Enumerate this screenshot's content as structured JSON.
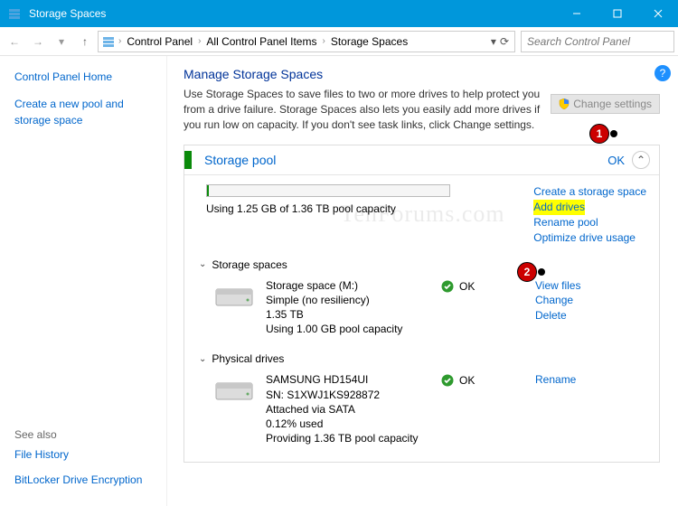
{
  "window": {
    "title": "Storage Spaces"
  },
  "nav": {
    "crumbs": [
      "Control Panel",
      "All Control Panel Items",
      "Storage Spaces"
    ],
    "search_placeholder": "Search Control Panel"
  },
  "sidebar": {
    "home": "Control Panel Home",
    "create": "Create a new pool and storage space",
    "seealso_label": "See also",
    "seealso": [
      "File History",
      "BitLocker Drive Encryption"
    ]
  },
  "main": {
    "heading": "Manage Storage Spaces",
    "description": "Use Storage Spaces to save files to two or more drives to help protect you from a drive failure. Storage Spaces also lets you easily add more drives if you run low on capacity. If you don't see task links, click Change settings.",
    "change_btn": "Change settings"
  },
  "pool": {
    "title": "Storage pool",
    "status": "OK",
    "usage": "Using 1.25 GB of 1.36 TB pool capacity",
    "actions": {
      "create": "Create a storage space",
      "add": "Add drives",
      "rename": "Rename pool",
      "optimize": "Optimize drive usage"
    }
  },
  "sections": {
    "spaces_label": "Storage spaces",
    "drives_label": "Physical drives"
  },
  "space_item": {
    "name": "Storage space (M:)",
    "resiliency": "Simple (no resiliency)",
    "size": "1.35 TB",
    "usage": "Using 1.00 GB pool capacity",
    "status": "OK",
    "actions": {
      "view": "View files",
      "change": "Change",
      "delete": "Delete"
    }
  },
  "drive_item": {
    "name": "SAMSUNG HD154UI",
    "sn": "SN: S1XWJ1KS928872",
    "attach": "Attached via SATA",
    "used": "0.12% used",
    "providing": "Providing 1.36 TB pool capacity",
    "status": "OK",
    "actions": {
      "rename": "Rename"
    }
  },
  "annotations": {
    "a1": "1",
    "a2": "2"
  },
  "watermark": "TenForums.com"
}
